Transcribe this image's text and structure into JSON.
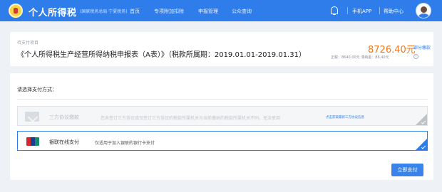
{
  "header": {
    "brand": "个人所得税",
    "brand_sub": "(国家税务总局·宁夏税务)",
    "nav": [
      "首页",
      "专项附加扣除",
      "申报管理",
      "公众查询"
    ],
    "mobile_app": "手机APP",
    "help": "帮助中心",
    "colors": {
      "bar": "#2f7dea"
    }
  },
  "payment": {
    "pending_label": "待支付项目",
    "title": "《个人所得税生产经营所得纳税申报表（A表）》（税款所属期：2019.01.01-2019.01.31）",
    "amount": "8726.40元",
    "partial_pay": "部分缴款",
    "breakdown": "正税：8640.00元   滞纳金：86.40元",
    "amount_color": "#f07820"
  },
  "methods": {
    "heading": "请选择支付方式：",
    "options": [
      {
        "label": "三方协议缴款",
        "desc": "您未签订三方协议或仅签订三方协议的税款所属机关与当前缴纳的税款所属机关不同，无法使用",
        "link": "点击获取最新三方协议信息",
        "icon": "agreement-icon",
        "enabled": false
      },
      {
        "label": "银联在线支付",
        "desc": "仅适用于加入银联的银行卡支付",
        "icon": "unionpay-icon",
        "enabled": true,
        "selected": true
      }
    ],
    "pay_button": "立即支付"
  }
}
